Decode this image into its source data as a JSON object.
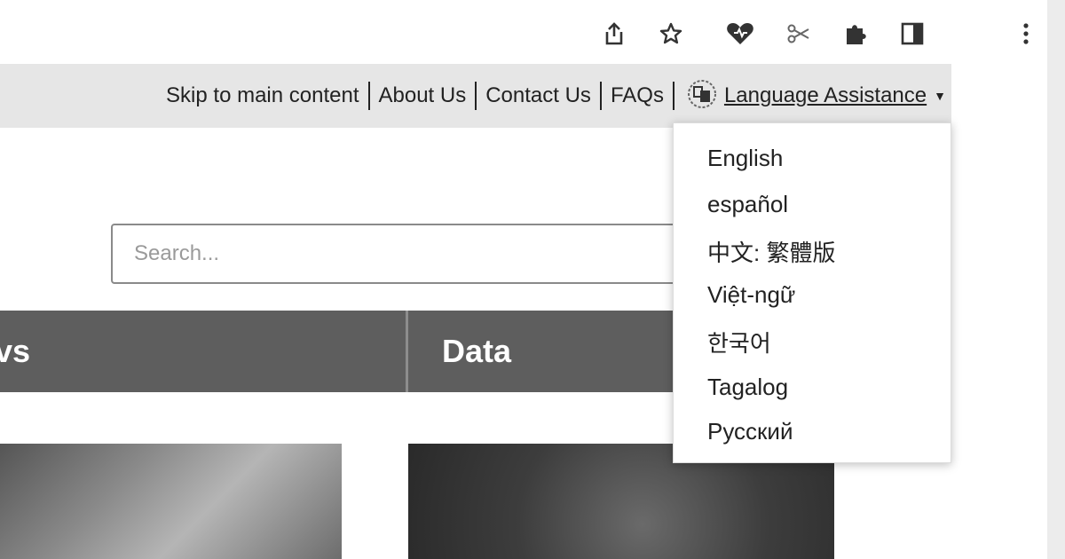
{
  "toolbar": {
    "icons": [
      "share-icon",
      "star-icon",
      "heart-extension-icon",
      "scissors-icon",
      "puzzle-icon",
      "side-panel-icon",
      "more-menu-icon"
    ]
  },
  "utility": {
    "links": [
      "Skip to main content",
      "About Us",
      "Contact Us",
      "FAQs"
    ],
    "language": "Language Assistance"
  },
  "search": {
    "placeholder": "Search..."
  },
  "nav": {
    "items": [
      "vs",
      "Data"
    ]
  },
  "language_menu": {
    "options": [
      "English",
      "español",
      "中文: 繁體版",
      "Việt-ngữ",
      "한국어",
      "Tagalog",
      "Русский"
    ]
  },
  "colors": {
    "nav_bg": "#5e5e5e",
    "util_bg": "#e6e6e6"
  }
}
